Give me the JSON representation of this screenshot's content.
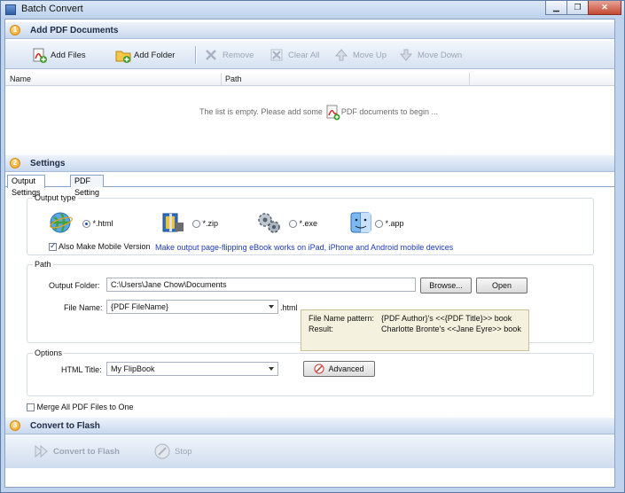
{
  "window": {
    "title": "Batch Convert",
    "controls": [
      "minimize",
      "restore",
      "close"
    ]
  },
  "sections": {
    "add": {
      "step": "1",
      "title": "Add PDF Documents"
    },
    "settings": {
      "step": "2",
      "title": "Settings"
    },
    "convert": {
      "step": "3",
      "title": "Convert to Flash"
    }
  },
  "toolbar": {
    "add_files": "Add Files",
    "add_folder": "Add Folder",
    "remove": "Remove",
    "clear_all": "Clear All",
    "move_up": "Move Up",
    "move_down": "Move Down"
  },
  "file_list": {
    "columns": [
      "Name",
      "Path"
    ],
    "empty_prefix": "The list is empty. Please add some",
    "empty_suffix": "PDF documents to begin ..."
  },
  "tabs": [
    {
      "label": "Output Settings",
      "active": true
    },
    {
      "label": "PDF Setting",
      "active": false
    }
  ],
  "output_type": {
    "group_label": "Output type",
    "options": [
      {
        "label": "*.html",
        "selected": true,
        "icon": "globe-icon"
      },
      {
        "label": "*.zip",
        "selected": false,
        "icon": "zip-archive-icon"
      },
      {
        "label": "*.exe",
        "selected": false,
        "icon": "gears-icon"
      },
      {
        "label": "*.app",
        "selected": false,
        "icon": "mac-finder-icon"
      }
    ],
    "mobile_checkbox_label": "Also Make Mobile Version",
    "mobile_checked": true,
    "mobile_note": "Make output page-flipping eBook works on iPad, iPhone and Android mobile devices"
  },
  "path": {
    "group_label": "Path",
    "output_folder_label": "Output Folder:",
    "output_folder_value": "C:\\Users\\Jane Chow\\Documents",
    "browse_label": "Browse...",
    "open_label": "Open",
    "file_name_label": "File Name:",
    "file_name_value": "{PDF FileName}",
    "file_ext": ".html",
    "pattern_label": "File Name pattern:",
    "pattern_value": "{PDF Author}'s <<{PDF Title}>> book",
    "result_label": "Result:",
    "result_value": "Charlotte Bronte's <<Jane Eyre>> book"
  },
  "options": {
    "group_label": "Options",
    "html_title_label": "HTML Title:",
    "html_title_value": "My FlipBook",
    "advanced_label": "Advanced"
  },
  "merge": {
    "label": "Merge All PDF Files to One",
    "checked": false
  },
  "convert": {
    "convert_label": "Convert to Flash",
    "stop_label": "Stop"
  },
  "colors": {
    "accent_blue": "#1d3ab8",
    "header_bg": "#c8d8ee",
    "step_orange": "#f0a21c"
  }
}
